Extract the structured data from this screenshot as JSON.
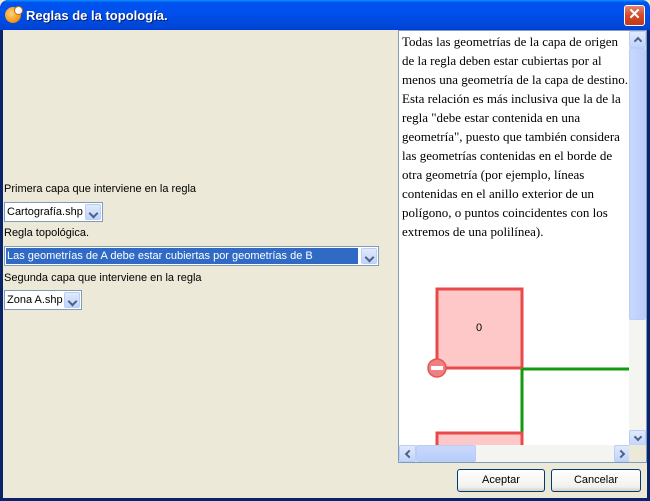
{
  "window": {
    "title": "Reglas de la topología."
  },
  "form": {
    "first_layer_label": "Primera capa que interviene en la regla",
    "first_layer_value": "Cartografía.shp",
    "rule_label": "Regla topológica.",
    "rule_value": "Las geometrías de A debe estar cubiertas por geometrías de B",
    "second_layer_label": "Segunda capa que interviene en la regla",
    "second_layer_value": "Zona A.shp"
  },
  "description": {
    "text": "Todas las geometrías de la capa de origen de la regla deben estar cubiertas por al menos una geometría de la capa de destino. Esta relación es más inclusiva que la de la regla \"debe estar contenida en una geometría\", puesto que también considera las geometrías contenidas en el borde de otra geometría (por ejemplo, líneas contenidas en el anillo exterior de un polígono, o puntos coincidentes con los extremos de una polilínea).",
    "illustration_label": "0"
  },
  "colors": {
    "polygon_stroke": "#e84a4a",
    "polygon_fill": "#ffc8c8",
    "line_stroke": "#129a12"
  },
  "buttons": {
    "accept": "Aceptar",
    "cancel": "Cancelar"
  }
}
